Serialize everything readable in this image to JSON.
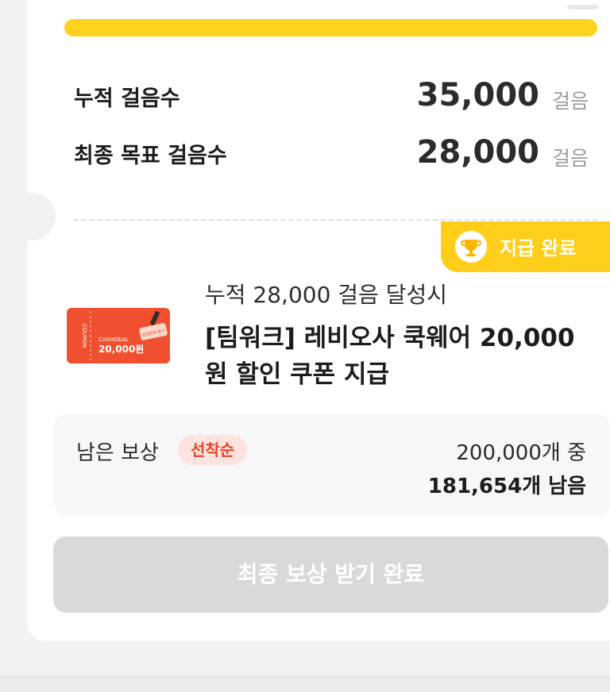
{
  "progress": {
    "fraction": 1.0
  },
  "stats": {
    "accumulated": {
      "label": "누적 걸음수",
      "value": "35,000",
      "unit": "걸음"
    },
    "goal": {
      "label": "최종 목표 걸음수",
      "value": "28,000",
      "unit": "걸음"
    }
  },
  "badge": {
    "label": "지급 완료",
    "icon": "trophy-icon"
  },
  "coupon": {
    "brand": "CASHDEAL",
    "side_text": "COUPON",
    "amount": "20,000원",
    "tag": "한정판매 특가"
  },
  "reward": {
    "condition": "누적 28,000 걸음 달성시",
    "title": "[팀워크] 레비오사 쿡웨어 20,000원 할인 쿠폰 지급"
  },
  "remaining": {
    "label": "남은 보상",
    "badge": "선착순",
    "total": "200,000개 중",
    "left": "181,654개 남음"
  },
  "button": {
    "label": "최종 보상 받기 완료"
  },
  "colors": {
    "accent": "#ffd21f",
    "badge_bg": "#ffce1a",
    "coupon": "#f0502f",
    "firstcome_bg": "#fde3df",
    "firstcome_text": "#e0472b",
    "disabled_button": "#d9d9db"
  }
}
